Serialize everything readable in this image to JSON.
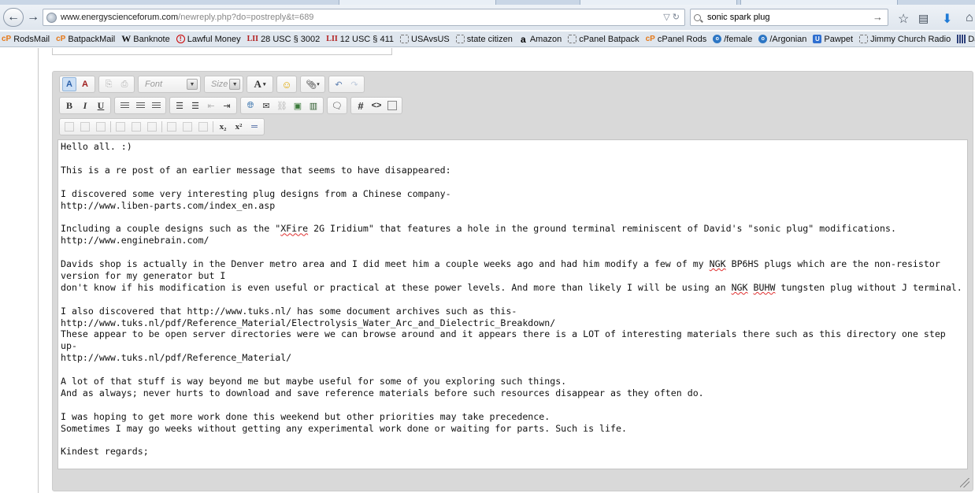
{
  "browser": {
    "url_host": "www.energyscienceforum.com",
    "url_path": "/newreply.php?do=postreply&t=689",
    "search_value": "sonic spark plug",
    "bookmarks": [
      {
        "label": "RodsMail",
        "icon": "cp-icon",
        "glyph": "cP"
      },
      {
        "label": "BatpackMail",
        "icon": "cp-icon",
        "glyph": "cP"
      },
      {
        "label": "Banknote",
        "icon": "w-icon",
        "glyph": "W"
      },
      {
        "label": "Lawful Money",
        "icon": "lawful-money-icon",
        "glyph": "!"
      },
      {
        "label": "28 USC § 3002",
        "icon": "lii-icon",
        "glyph": "LII"
      },
      {
        "label": "12 USC § 411",
        "icon": "lii-icon",
        "glyph": "LII"
      },
      {
        "label": "USAvsUS",
        "icon": "blank-page-icon",
        "glyph": ""
      },
      {
        "label": "state citizen",
        "icon": "blank-page-icon",
        "glyph": ""
      },
      {
        "label": "Amazon",
        "icon": "amazon-icon",
        "glyph": "a"
      },
      {
        "label": "cPanel Batpack",
        "icon": "blank-page-icon",
        "glyph": ""
      },
      {
        "label": "cPanel Rods",
        "icon": "cp-icon",
        "glyph": "cP"
      },
      {
        "label": "/female",
        "icon": "forum-icon",
        "glyph": "o"
      },
      {
        "label": "/Argonian",
        "icon": "forum-icon",
        "glyph": "o"
      },
      {
        "label": "Pawpet",
        "icon": "pawpet-icon",
        "glyph": "U"
      },
      {
        "label": "Jimmy Church Radio",
        "icon": "blank-page-icon",
        "glyph": ""
      },
      {
        "label": "Dark Matter Ra",
        "icon": "grid-icon",
        "glyph": ""
      }
    ]
  },
  "editor": {
    "font_placeholder": "Font",
    "size_placeholder": "Size",
    "font_color_glyph": "A",
    "bold": "B",
    "italic": "I",
    "underline": "U",
    "hash": "#",
    "code": "<>",
    "sub": "x₂",
    "sup": "x²",
    "content_lines": [
      {
        "segs": [
          {
            "t": "Hello all. :)"
          }
        ]
      },
      {
        "gap": true
      },
      {
        "segs": [
          {
            "t": "This is a re post of an earlier message that seems to have disappeared:"
          }
        ]
      },
      {
        "gap": true
      },
      {
        "segs": [
          {
            "t": "I discovered some very interesting plug designs from a Chinese company-"
          }
        ]
      },
      {
        "segs": [
          {
            "t": "http://www.liben-parts.com/index_en.asp"
          }
        ]
      },
      {
        "gap": true
      },
      {
        "segs": [
          {
            "t": "Including a couple designs such as the \""
          },
          {
            "t": "XFire",
            "spell": true
          },
          {
            "t": " 2G Iridium\" that features a hole in the ground terminal reminiscent of David's \"sonic plug\" modifications."
          }
        ]
      },
      {
        "segs": [
          {
            "t": "http://www.enginebrain.com/"
          }
        ]
      },
      {
        "gap": true
      },
      {
        "segs": [
          {
            "t": "Davids shop is actually in the Denver metro area and I did meet him a couple weeks ago and had him modify a few of my "
          },
          {
            "t": "NGK",
            "spell": true
          },
          {
            "t": " BP6HS plugs which are the non-resistor version for my generator but I"
          }
        ]
      },
      {
        "segs": [
          {
            "t": "don't know if his modification is even useful or practical at these power levels. And more than likely I will be using an "
          },
          {
            "t": "NGK",
            "spell": true
          },
          {
            "t": " "
          },
          {
            "t": "BUHW",
            "spell": true
          },
          {
            "t": " tungsten plug without J terminal."
          }
        ]
      },
      {
        "gap": true
      },
      {
        "segs": [
          {
            "t": "I also discovered that http://www.tuks.nl/ has some document archives such as this-"
          }
        ]
      },
      {
        "segs": [
          {
            "t": "http://www.tuks.nl/pdf/Reference_Material/Electrolysis_Water_Arc_and_Dielectric_Breakdown/"
          }
        ]
      },
      {
        "segs": [
          {
            "t": "These appear to be open server directories were we can browse around and it appears there is a LOT of interesting materials there such as this directory one step up-"
          }
        ]
      },
      {
        "segs": [
          {
            "t": "http://www.tuks.nl/pdf/Reference_Material/"
          }
        ]
      },
      {
        "gap": true
      },
      {
        "segs": [
          {
            "t": "A lot of that stuff is way beyond me but maybe useful for some of you exploring such things."
          }
        ]
      },
      {
        "segs": [
          {
            "t": "And as always; never hurts to download and save reference materials before such resources disappear as they often do."
          }
        ]
      },
      {
        "gap": true
      },
      {
        "segs": [
          {
            "t": "I was hoping to get more work done this weekend but other priorities may take precedence."
          }
        ]
      },
      {
        "segs": [
          {
            "t": "Sometimes I may go weeks without getting any experimental work done or waiting for parts. Such is life."
          }
        ]
      },
      {
        "gap": true
      },
      {
        "segs": [
          {
            "t": "Kindest regards;"
          }
        ]
      },
      {
        "gap": true
      },
      {
        "segs": [
          {
            "t": "}:>"
          }
        ]
      }
    ]
  },
  "colors": {
    "chrome_bg": "#dfe6ee",
    "editor_frame": "#d9d9d9",
    "spell_underline": "#e03030"
  }
}
